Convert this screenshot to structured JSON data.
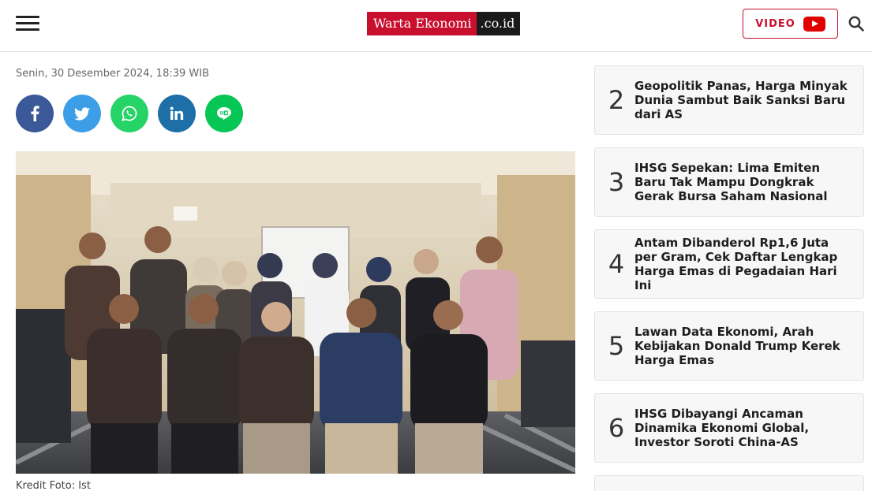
{
  "header": {
    "logo_main": "Warta Ekonomi",
    "logo_suffix": ".co.id",
    "video_label": "VIDEO"
  },
  "article": {
    "date": "Senin, 30 Desember 2024, 18:39 WIB",
    "photo_credit": "Kredit Foto: Ist"
  },
  "sidebar": {
    "items": [
      {
        "number": "2",
        "title": "Geopolitik Panas, Harga Minyak Dunia Sambut Baik Sanksi Baru dari AS"
      },
      {
        "number": "3",
        "title": "IHSG Sepekan: Lima Emiten Baru Tak Mampu Dongkrak Gerak Bursa Saham Nasional"
      },
      {
        "number": "4",
        "title": "Antam Dibanderol Rp1,6 Juta per Gram, Cek Daftar Lengkap Harga Emas di Pegadaian Hari Ini"
      },
      {
        "number": "5",
        "title": "Lawan Data Ekonomi, Arah Kebijakan Donald Trump Kerek Harga Emas"
      },
      {
        "number": "6",
        "title": "IHSG Dibayangi Ancaman Dinamika Ekonomi Global, Investor Soroti China-AS"
      }
    ]
  },
  "colors": {
    "brand_red": "#c8102e",
    "facebook": "#3b5998",
    "twitter": "#3d9ee8",
    "whatsapp": "#25d366",
    "linkedin": "#1e6fa8",
    "line": "#06c755"
  },
  "icons": {
    "menu": "hamburger-menu-icon",
    "video": "youtube-play-icon",
    "search": "search-icon",
    "share": [
      "facebook-icon",
      "twitter-icon",
      "whatsapp-icon",
      "linkedin-icon",
      "line-icon"
    ]
  }
}
